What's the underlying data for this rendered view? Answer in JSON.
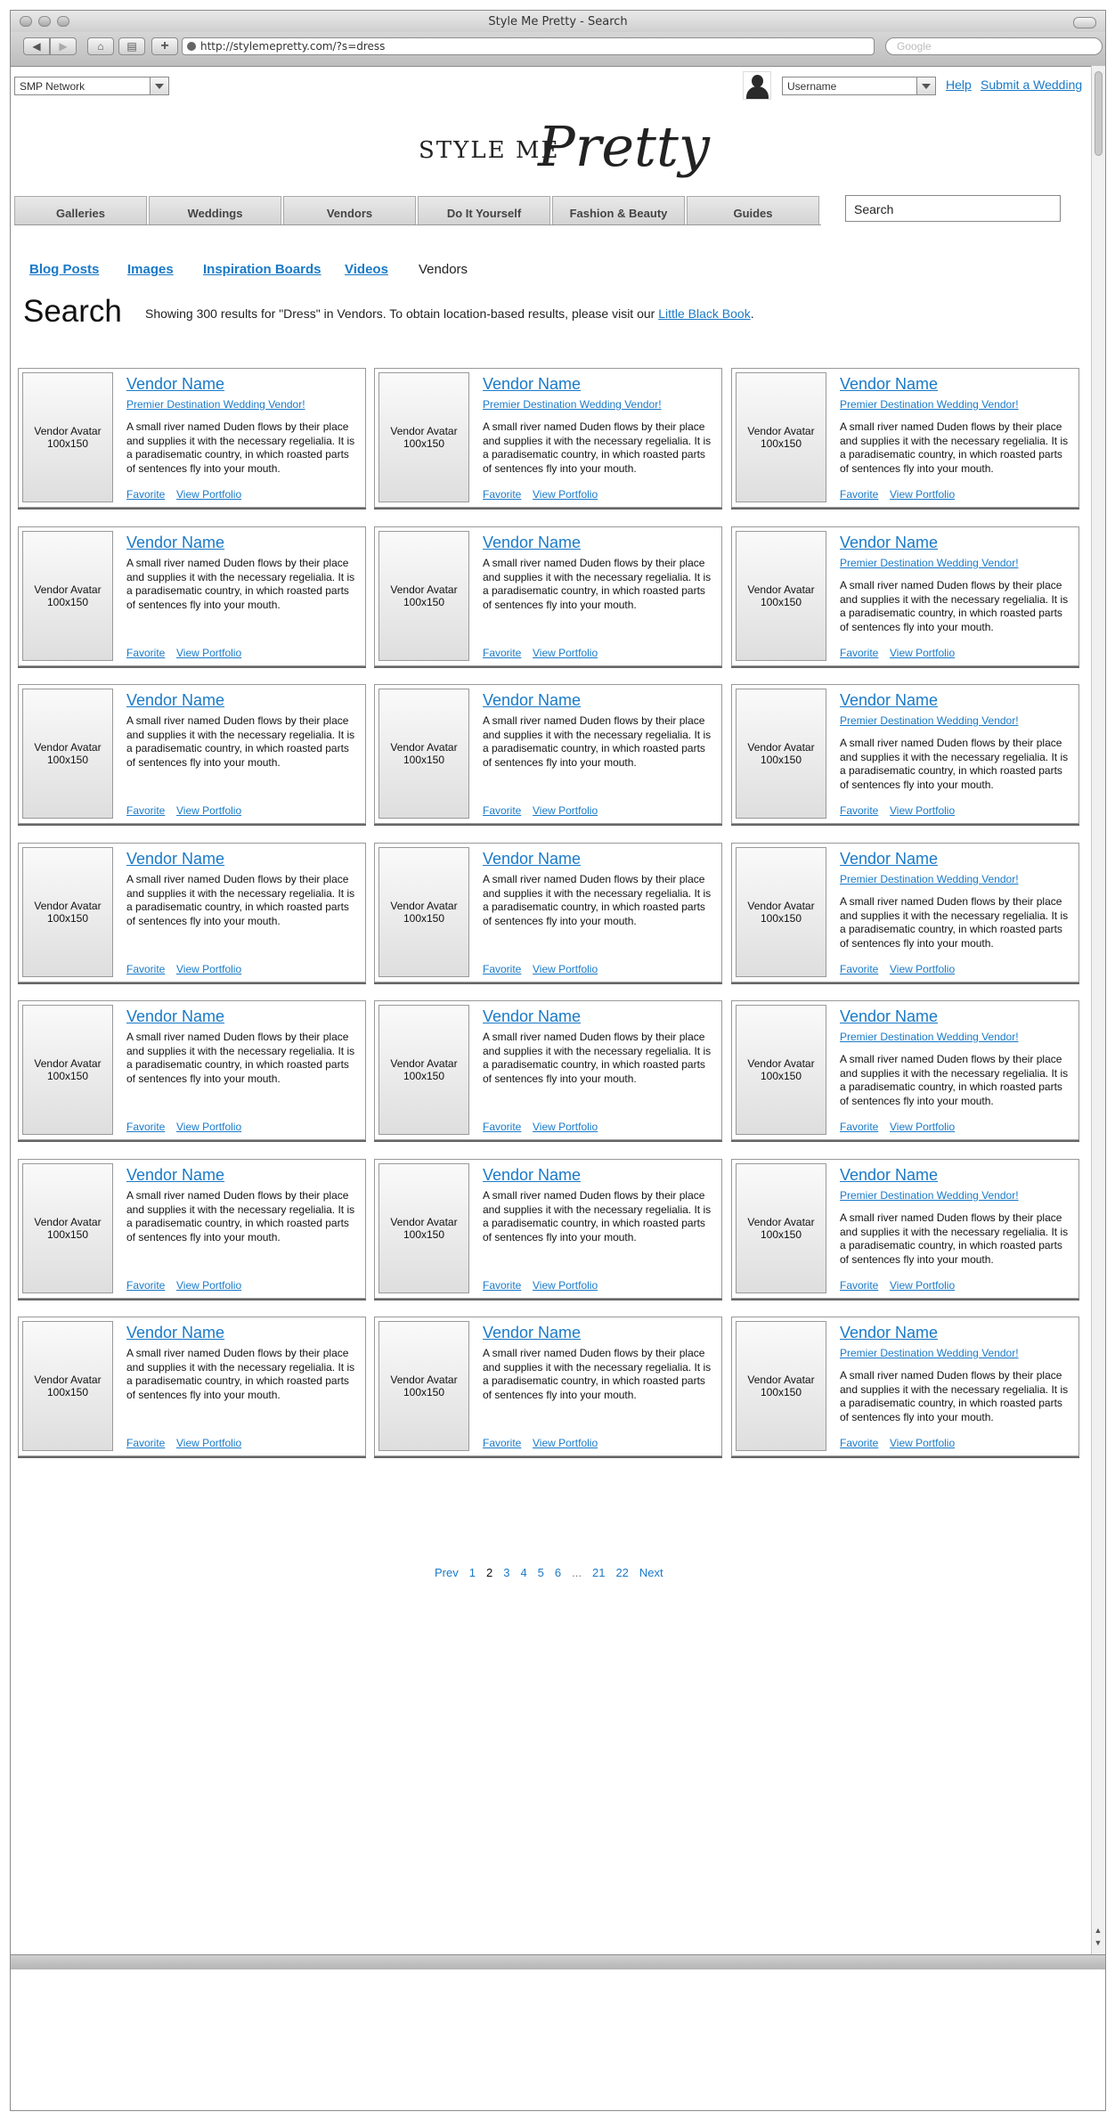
{
  "browser": {
    "window_title": "Style Me Pretty - Search",
    "url": "http://stylemepretty.com/?s=dress",
    "search_placeholder": "Google"
  },
  "topbar": {
    "network_select": "SMP Network",
    "username_select": "Username",
    "help_link": "Help",
    "submit_link": "Submit a Wedding"
  },
  "logo": {
    "part1": "STYLE ME",
    "part2": "Pretty"
  },
  "nav": {
    "tabs": [
      "Galleries",
      "Weddings",
      "Vendors",
      "Do It Yourself",
      "Fashion & Beauty",
      "Guides"
    ],
    "search_value": "Search"
  },
  "subnav": {
    "items": [
      "Blog Posts",
      "Images",
      "Inspiration Boards",
      "Videos",
      "Vendors"
    ],
    "active": "Vendors"
  },
  "search": {
    "title": "Search",
    "summary_prefix": "Showing 300 results for \"Dress\" in Vendors. To obtain location-based results, please visit our ",
    "summary_link": "Little Black Book",
    "summary_suffix": "."
  },
  "card_template": {
    "avatar_label_line1": "Vendor Avatar",
    "avatar_label_line2": "100x150",
    "name": "Vendor Name",
    "tagline": "Premier Destination Wedding Vendor!",
    "description_lines": [
      "A small river named Duden flows by their place",
      "and supplies it with the necessary regelialia. It is",
      "a paradisematic country, in which roasted parts",
      "of sentences fly into your mouth."
    ],
    "favorite_link": "Favorite",
    "portfolio_link": "View Portfolio"
  },
  "results": [
    {
      "has_tagline": true
    },
    {
      "has_tagline": true
    },
    {
      "has_tagline": true
    },
    {
      "has_tagline": false
    },
    {
      "has_tagline": false
    },
    {
      "has_tagline": true
    },
    {
      "has_tagline": false
    },
    {
      "has_tagline": false
    },
    {
      "has_tagline": true
    },
    {
      "has_tagline": false
    },
    {
      "has_tagline": false
    },
    {
      "has_tagline": true
    },
    {
      "has_tagline": false
    },
    {
      "has_tagline": false
    },
    {
      "has_tagline": true
    },
    {
      "has_tagline": false
    },
    {
      "has_tagline": false
    },
    {
      "has_tagline": true
    },
    {
      "has_tagline": false
    },
    {
      "has_tagline": false
    },
    {
      "has_tagline": true
    }
  ],
  "pagination": {
    "prev": "Prev",
    "pages": [
      "1",
      "2",
      "3",
      "4",
      "5",
      "6",
      "...",
      "21",
      "22"
    ],
    "current": "2",
    "next": "Next"
  }
}
